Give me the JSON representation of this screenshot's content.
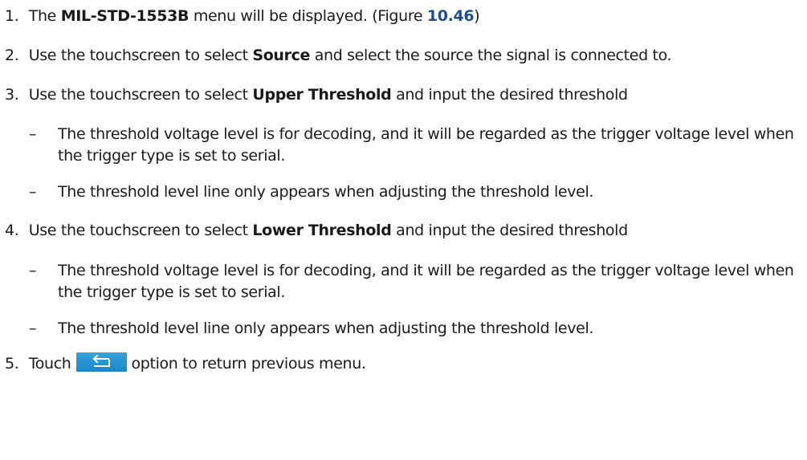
{
  "steps": [
    {
      "num": "1.",
      "pre": "The ",
      "bold": "MIL-STD-1553B",
      "mid": " menu will be displayed. (Figure ",
      "figref": "10.46",
      "post": ")"
    },
    {
      "num": "2.",
      "pre": "Use the touchscreen to select ",
      "bold": "Source",
      "post": " and select the source the signal is connected to."
    },
    {
      "num": "3.",
      "pre": "Use the touchscreen to select ",
      "bold": "Upper Threshold",
      "post": " and input the desired threshold",
      "bullets": [
        "The threshold voltage level is for decoding, and it will be regarded as the trigger voltage level when the trigger type is set to serial.",
        "The threshold level line only appears when adjusting the threshold level."
      ]
    },
    {
      "num": "4.",
      "pre": "Use the touchscreen to select ",
      "bold": "Lower Threshold",
      "post": " and input the desired threshold",
      "bullets": [
        "The threshold voltage level is for decoding, and it will be regarded as the trigger voltage level when the trigger type is set to serial.",
        "The threshold level line only appears when adjusting the threshold level."
      ]
    },
    {
      "num": "5.",
      "pre": "Touch",
      "icon": "return-arrow-icon",
      "post": "option to return previous menu."
    }
  ],
  "bullet_marker": "–",
  "colors": {
    "figref": "#1f4e8c",
    "button": "#2596d6"
  }
}
